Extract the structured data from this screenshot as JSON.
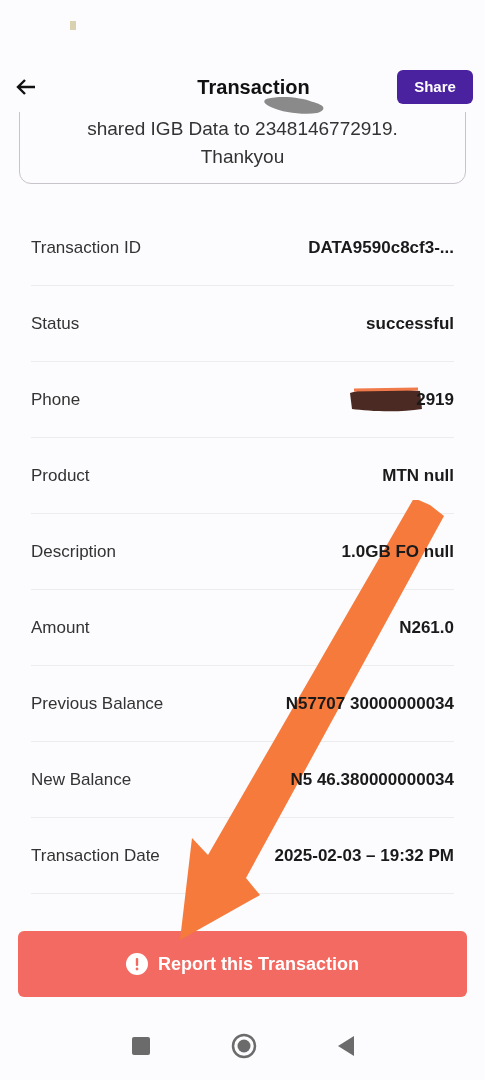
{
  "header": {
    "title": "Transaction",
    "share_button": "Share"
  },
  "message": {
    "lines": [
      "shared IGB Data to 2348146772919.",
      "Thankyou"
    ]
  },
  "details": [
    {
      "label": "Transaction ID",
      "value": "DATA9590c8cf3-..."
    },
    {
      "label": "Status",
      "value": "successful"
    },
    {
      "label": "Phone",
      "value": "2919",
      "redacted": true
    },
    {
      "label": "Product",
      "value": "MTN null"
    },
    {
      "label": "Description",
      "value": "1.0GB FO null"
    },
    {
      "label": "Amount",
      "value": "N261.0"
    },
    {
      "label": "Previous Balance",
      "value": "N57707 30000000034"
    },
    {
      "label": "New Balance",
      "value": "N5 46.380000000034"
    },
    {
      "label": "Transaction Date",
      "value": "2025-02-03 – 19:32 PM"
    }
  ],
  "report_button": "Report this Transaction"
}
